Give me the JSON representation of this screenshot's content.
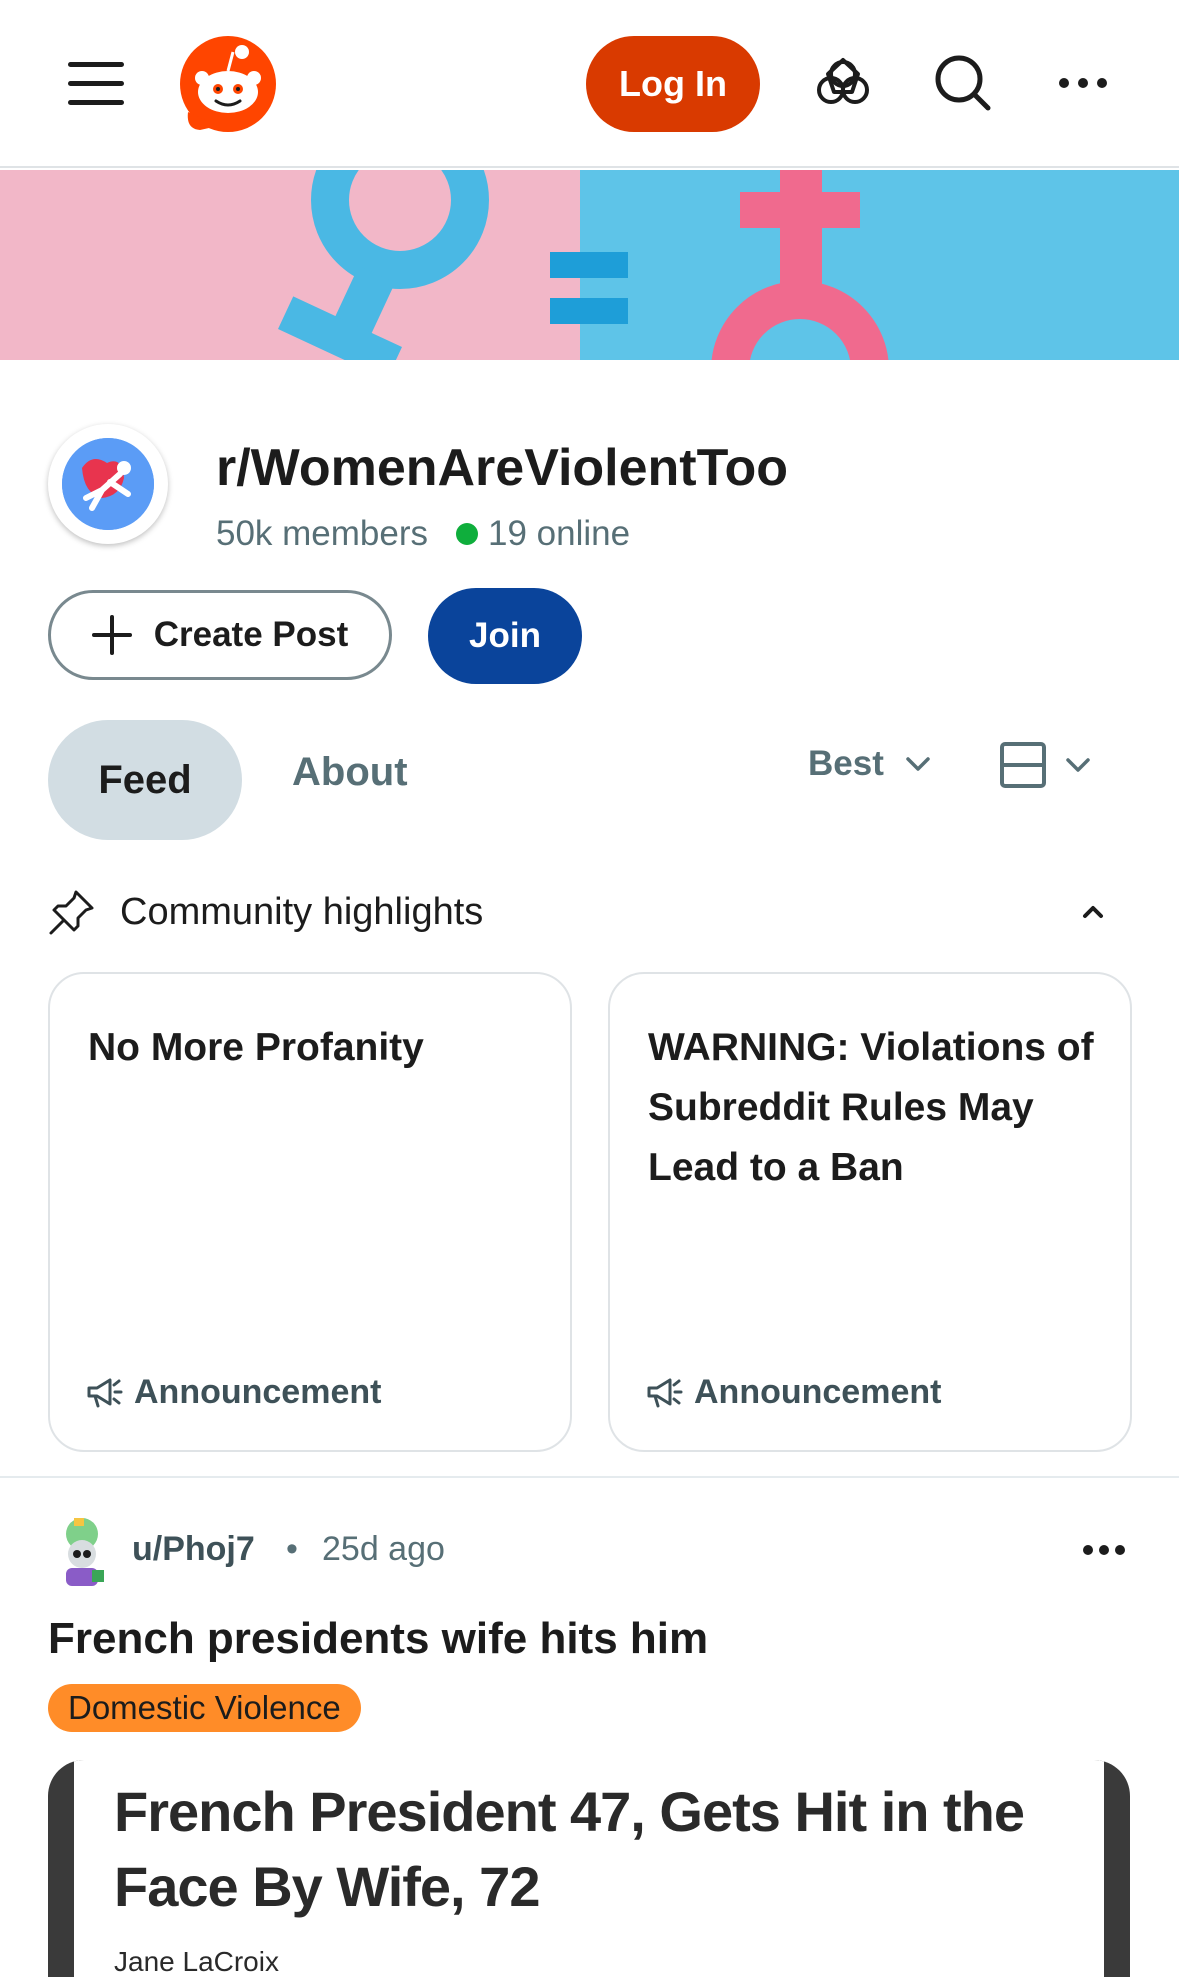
{
  "header": {
    "login_label": "Log In",
    "icons": [
      "menu-icon",
      "reddit-logo",
      "advertise-icon",
      "search-icon",
      "more-icon"
    ],
    "accent_color": "#d93a00"
  },
  "community": {
    "name": "r/WomenAreViolentToo",
    "members": "50k members",
    "online": "19 online",
    "create_post_label": "Create Post",
    "join_label": "Join",
    "join_color": "#0a449b"
  },
  "tabs": {
    "feed": "Feed",
    "about": "About",
    "sort": "Best"
  },
  "highlights": {
    "title": "Community highlights",
    "cards": [
      {
        "title": "No More Profanity",
        "tag": "Announcement"
      },
      {
        "title": "WARNING: Violations of Subreddit Rules May Lead to a Ban",
        "tag": "Announcement"
      }
    ]
  },
  "post": {
    "author": "u/Phoj7",
    "separator": "•",
    "time": "25d ago",
    "title": "French presidents wife hits him",
    "flair": "Domestic Violence",
    "flair_color": "#ff8c28",
    "image_headline": "French President 47, Gets Hit in the Face By Wife, 72",
    "image_byline": "Jane LaCroix"
  }
}
